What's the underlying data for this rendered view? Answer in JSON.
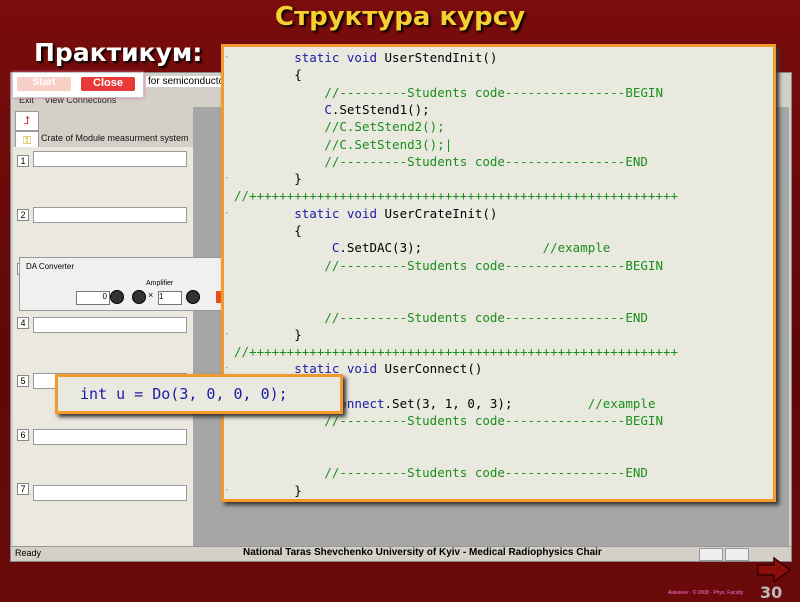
{
  "slide": {
    "title": "Структура курсу",
    "subtitle": "Практикум:",
    "page_number": "30",
    "footer_tiny": "Alekseev · © 2008 · Phys. Faculty"
  },
  "colors": {
    "background": "#6b0a0a",
    "title": "#f4d030",
    "panel_border": "#f29a2e",
    "keyword": "#1a1aa6",
    "comment": "#1b8f1b"
  },
  "popup": {
    "start_label": "Start",
    "close_label": "Close",
    "window_title_fragment": "for semiconductor"
  },
  "app": {
    "menu": [
      "Exit",
      "View Connections"
    ],
    "toolbar_icons": [
      "connect-icon",
      "key-icon"
    ],
    "module_title": "Crate of Module measurment system",
    "rack_numbers": [
      "1",
      "2",
      "3",
      "4",
      "5",
      "6",
      "7"
    ],
    "da_converter": {
      "title": "DA Converter",
      "amplifier_label": "Amplifier",
      "input_value": "0",
      "multiplier": "×",
      "gain_value": "1",
      "output_value": "1"
    },
    "status_ready": "Ready",
    "status_center": "National Taras Shevchenko University of Kyiv - Medical Radiophysics Chair"
  },
  "code": {
    "lines": [
      {
        "marker": "-",
        "indent": "        ",
        "parts": [
          [
            "kw",
            "static void "
          ],
          [
            "plain",
            "UserStendInit()"
          ]
        ]
      },
      {
        "marker": "",
        "indent": "        ",
        "parts": [
          [
            "plain",
            "{"
          ]
        ]
      },
      {
        "marker": "",
        "indent": "            ",
        "parts": [
          [
            "cmt",
            "//---------Students code----------------BEGIN"
          ]
        ]
      },
      {
        "marker": "",
        "indent": "            ",
        "parts": [
          [
            "id",
            "C"
          ],
          [
            "plain",
            ".SetStend1();"
          ]
        ]
      },
      {
        "marker": "",
        "indent": "            ",
        "parts": [
          [
            "cmt",
            "//C.SetStend2();"
          ]
        ]
      },
      {
        "marker": "",
        "indent": "            ",
        "parts": [
          [
            "cmt",
            "//C.SetStend3();|"
          ]
        ]
      },
      {
        "marker": "",
        "indent": "            ",
        "parts": [
          [
            "cmt",
            "//---------Students code----------------END"
          ]
        ]
      },
      {
        "marker": "-",
        "indent": "        ",
        "parts": [
          [
            "plain",
            "}"
          ]
        ]
      },
      {
        "marker": "",
        "indent": "",
        "parts": [
          [
            "cmt",
            "//+++++++++++++++++++++++++++++++++++++++++++++++++++++++++"
          ]
        ]
      },
      {
        "marker": "-",
        "indent": "        ",
        "parts": [
          [
            "kw",
            "static void "
          ],
          [
            "plain",
            "UserCrateInit()"
          ]
        ]
      },
      {
        "marker": "",
        "indent": "        ",
        "parts": [
          [
            "plain",
            "{"
          ]
        ]
      },
      {
        "marker": "",
        "indent": "             ",
        "parts": [
          [
            "id",
            "C"
          ],
          [
            "plain",
            ".SetDAC(3);                "
          ],
          [
            "cmt",
            "//example"
          ]
        ]
      },
      {
        "marker": "",
        "indent": "            ",
        "parts": [
          [
            "cmt",
            "//---------Students code----------------BEGIN"
          ]
        ]
      },
      {
        "marker": "",
        "indent": "",
        "parts": []
      },
      {
        "marker": "",
        "indent": "",
        "parts": []
      },
      {
        "marker": "",
        "indent": "            ",
        "parts": [
          [
            "cmt",
            "//---------Students code----------------END"
          ]
        ]
      },
      {
        "marker": "-",
        "indent": "        ",
        "parts": [
          [
            "plain",
            "}"
          ]
        ]
      },
      {
        "marker": "",
        "indent": "",
        "parts": [
          [
            "cmt",
            "//+++++++++++++++++++++++++++++++++++++++++++++++++++++++++"
          ]
        ]
      },
      {
        "marker": "-",
        "indent": "        ",
        "parts": [
          [
            "kw",
            "static void "
          ],
          [
            "plain",
            "UserConnect()"
          ]
        ]
      },
      {
        "marker": "",
        "indent": "",
        "parts": []
      },
      {
        "marker": "",
        "indent": "             ",
        "parts": [
          [
            "id",
            "Connect"
          ],
          [
            "plain",
            ".Set(3, 1, 0, 3);          "
          ],
          [
            "cmt",
            "//example"
          ]
        ]
      },
      {
        "marker": "",
        "indent": "            ",
        "parts": [
          [
            "cmt",
            "//---------Students code----------------BEGIN"
          ]
        ]
      },
      {
        "marker": "",
        "indent": "",
        "parts": []
      },
      {
        "marker": "",
        "indent": "",
        "parts": []
      },
      {
        "marker": "",
        "indent": "            ",
        "parts": [
          [
            "cmt",
            "//---------Students code----------------END"
          ]
        ]
      },
      {
        "marker": "-",
        "indent": "        ",
        "parts": [
          [
            "plain",
            "}"
          ]
        ]
      }
    ]
  },
  "callout": {
    "code": "int u = Do(3, 0, 0, 0);"
  }
}
